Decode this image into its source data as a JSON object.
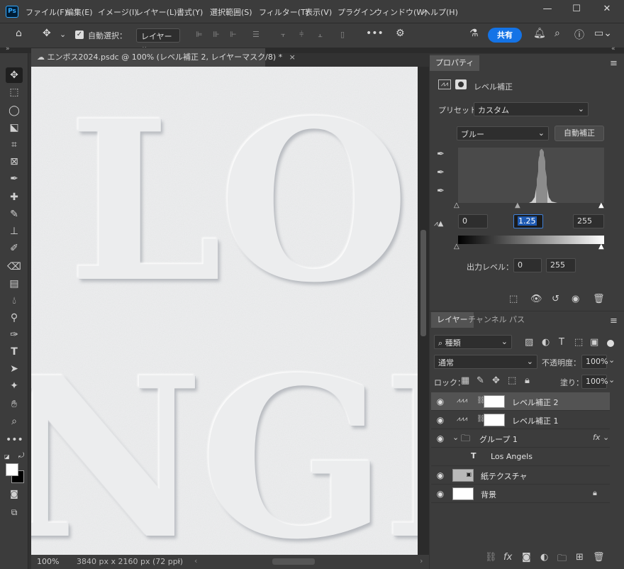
{
  "app": {
    "logo": "Ps"
  },
  "menu": [
    "ファイル(F)",
    "編集(E)",
    "イメージ(I)",
    "レイヤー(L)",
    "書式(Y)",
    "選択範囲(S)",
    "フィルター(T)",
    "表示(V)",
    "プラグイン",
    "ウィンドウ(W)",
    "ヘルプ(H)"
  ],
  "window_controls": {
    "minimize": "—",
    "maximize": "☐",
    "close": "✕"
  },
  "options": {
    "auto_select_label": "自動選択：",
    "auto_select_target": "レイヤー",
    "share_label": "共有"
  },
  "document": {
    "tab_title": "エンボス2024.psdc @ 100% (レベル補正 2, レイヤーマスク/8) *",
    "canvas_text_line1": "LO",
    "canvas_text_line2": "NGI"
  },
  "status": {
    "zoom": "100%",
    "doc_size": "3840 px x 2160 px (72 ppi)",
    "nav_arrow": "›"
  },
  "properties": {
    "tab": "プロパティ",
    "type_label": "レベル補正",
    "preset_label": "プリセット：",
    "preset_value": "カスタム",
    "channel_value": "ブルー",
    "auto_button": "自動補正",
    "input_black": "0",
    "input_gamma": "1.25",
    "input_white": "255",
    "output_label": "出力レベル：",
    "output_black": "0",
    "output_white": "255"
  },
  "layers_panel": {
    "tabs": [
      "レイヤー",
      "チャンネル",
      "パス"
    ],
    "filter_kind": "種類",
    "blend_mode": "通常",
    "opacity_label": "不透明度：",
    "opacity_value": "100%",
    "lock_label": "ロック：",
    "fill_label": "塗り：",
    "fill_value": "100%",
    "layers": [
      {
        "name": "レベル補正 2",
        "selected": true
      },
      {
        "name": "レベル補正 1",
        "selected": false
      },
      {
        "name": "グループ 1",
        "selected": false,
        "fx": "fx"
      },
      {
        "name": "Los Angels",
        "selected": false
      },
      {
        "name": "紙テクスチャ",
        "selected": false
      },
      {
        "name": "背景",
        "selected": false
      }
    ]
  },
  "histogram": {
    "peak_fraction_x": 0.57
  }
}
